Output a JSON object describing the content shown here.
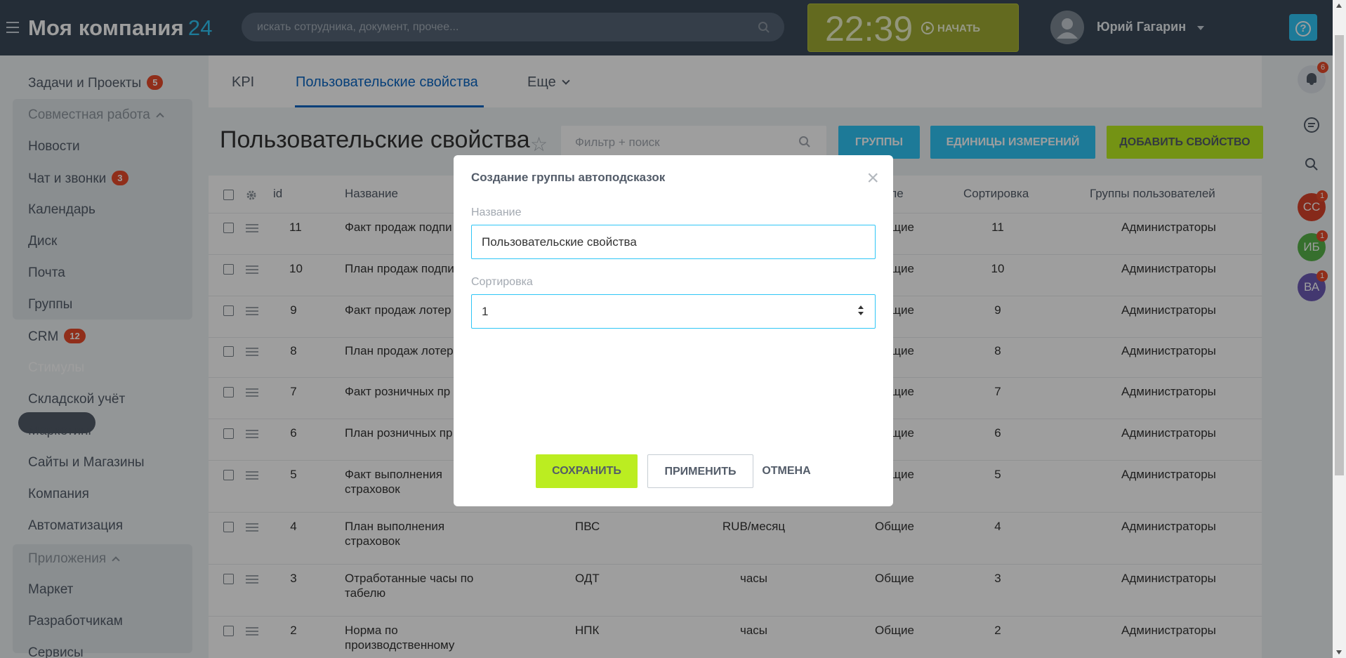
{
  "header": {
    "logo_text": "Моя компания",
    "logo_number": "24",
    "search_placeholder": "искать сотрудника, документ, прочее...",
    "clock_time": "22:39",
    "clock_start_label": "НАЧАТЬ",
    "user_name": "Юрий Гагарин",
    "help_label": "?"
  },
  "sidebar": {
    "items": [
      {
        "label": "Задачи и Проекты",
        "badge": "5"
      },
      {
        "label": "Совместная работа"
      },
      {
        "label": "Новости"
      },
      {
        "label": "Чат и звонки",
        "badge": "3"
      },
      {
        "label": "Календарь"
      },
      {
        "label": "Диск"
      },
      {
        "label": "Почта"
      },
      {
        "label": "Группы"
      },
      {
        "label": "CRM",
        "badge": "12"
      },
      {
        "label": "Стимулы"
      },
      {
        "label": "Складской учёт"
      },
      {
        "label": "Маркетинг"
      },
      {
        "label": "Сайты и Магазины"
      },
      {
        "label": "Компания"
      },
      {
        "label": "Автоматизация"
      },
      {
        "label": "Приложения"
      },
      {
        "label": "Маркет"
      },
      {
        "label": "Разработчикам"
      },
      {
        "label": "Сервисы"
      }
    ]
  },
  "right_panel": {
    "notifications_badge": "6",
    "users": [
      {
        "initials": "СС",
        "badge": "1",
        "color": "#d9432b"
      },
      {
        "initials": "ИБ",
        "badge": "1",
        "color": "#58b34a"
      },
      {
        "initials": "ВА",
        "badge": "1",
        "color": "#6d5bb5"
      }
    ]
  },
  "tabs": [
    "KPI",
    "Пользовательские свойства",
    "Еще"
  ],
  "page": {
    "title": "Пользовательские свойства",
    "filter_placeholder": "Фильтр + поиск",
    "btn_groups": "ГРУППЫ",
    "btn_units": "ЕДИНИЦЫ ИЗМЕРЕНИЙ",
    "btn_add": "ДОБАВИТЬ СВОЙСТВО"
  },
  "table": {
    "headers": {
      "id": "id",
      "name": "Название",
      "type_tail": "пе",
      "sort": "Сортировка",
      "groups": "Группы пользователей"
    },
    "rows": [
      {
        "id": "11",
        "name1": "Факт продаж подпи",
        "name2": "",
        "code": "",
        "unit": "",
        "type": "Общие",
        "sort": "11",
        "groups": "Администраторы"
      },
      {
        "id": "10",
        "name1": "План продаж подпи",
        "name2": "",
        "code": "",
        "unit": "",
        "type": "Общие",
        "sort": "10",
        "groups": "Администраторы"
      },
      {
        "id": "9",
        "name1": "Факт продаж лотер",
        "name2": "",
        "code": "",
        "unit": "",
        "type": "Общие",
        "sort": "9",
        "groups": "Администраторы"
      },
      {
        "id": "8",
        "name1": "План продаж лотер",
        "name2": "",
        "code": "",
        "unit": "",
        "type": "Общие",
        "sort": "8",
        "groups": "Администраторы"
      },
      {
        "id": "7",
        "name1": "Факт розничных пр",
        "name2": "",
        "code": "",
        "unit": "",
        "type": "Общие",
        "sort": "7",
        "groups": "Администраторы"
      },
      {
        "id": "6",
        "name1": "План розничных пр",
        "name2": "",
        "code": "",
        "unit": "",
        "type": "Общие",
        "sort": "6",
        "groups": "Администраторы"
      },
      {
        "id": "5",
        "name1": "Факт выполнения",
        "name2": "страховок",
        "code": "",
        "unit": "",
        "type": "Общие",
        "sort": "5",
        "groups": "Администраторы"
      },
      {
        "id": "4",
        "name1": "План выполнения",
        "name2": "страховок",
        "code": "ПВС",
        "unit": "RUB/месяц",
        "type": "Общие",
        "sort": "4",
        "groups": "Администраторы"
      },
      {
        "id": "3",
        "name1": "Отработанные часы по",
        "name2": "табелю",
        "code": "ОДТ",
        "unit": "часы",
        "type": "Общие",
        "sort": "3",
        "groups": "Администраторы"
      },
      {
        "id": "2",
        "name1": "Норма по",
        "name2": "производственному",
        "code": "НПК",
        "unit": "часы",
        "type": "Общие",
        "sort": "2",
        "groups": "Администраторы"
      }
    ]
  },
  "modal": {
    "title": "Создание группы автоподсказок",
    "name_label": "Название",
    "name_value": "Пользовательские свойства",
    "sort_label": "Сортировка",
    "sort_value": "1",
    "save": "СОХРАНИТЬ",
    "apply": "ПРИМЕНИТЬ",
    "cancel": "ОТМЕНА"
  },
  "colors": {
    "header_bg": "#3b4a5a",
    "accent_blue": "#2fc6f6",
    "lime": "#bbed21",
    "clock_bg": "#a1ac33"
  }
}
